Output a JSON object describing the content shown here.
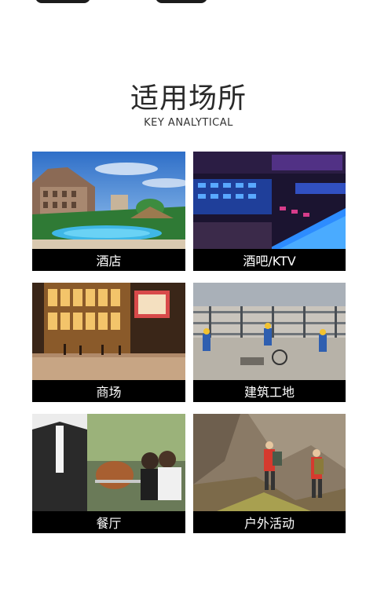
{
  "header": {
    "title": "适用场所",
    "subtitle": "KEY ANALYTICAL"
  },
  "places": [
    {
      "label": "酒店",
      "image": "hotel-pool-photo"
    },
    {
      "label": "酒吧/KTV",
      "image": "bar-ktv-photo"
    },
    {
      "label": "商场",
      "image": "shopping-mall-photo"
    },
    {
      "label": "建筑工地",
      "image": "construction-site-photo"
    },
    {
      "label": "餐厅",
      "image": "restaurant-photo"
    },
    {
      "label": "户外活动",
      "image": "outdoor-hiking-photo"
    }
  ]
}
